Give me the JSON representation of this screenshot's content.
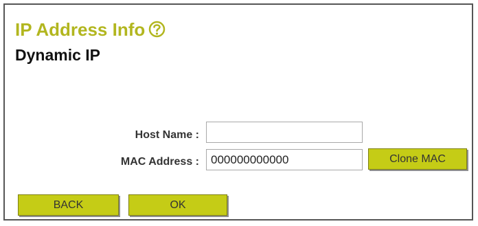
{
  "header": {
    "title": "IP Address Info",
    "subtitle": "Dynamic IP",
    "help_icon": "question-circle-icon"
  },
  "form": {
    "host_name_label": "Host Name :",
    "host_name_value": "",
    "mac_address_label": "MAC Address :",
    "mac_address_value": "000000000000",
    "clone_mac_label": "Clone MAC"
  },
  "footer": {
    "back_label": "BACK",
    "ok_label": "OK"
  },
  "colors": {
    "title": "#b2b61f",
    "button": "#c5cc16"
  }
}
